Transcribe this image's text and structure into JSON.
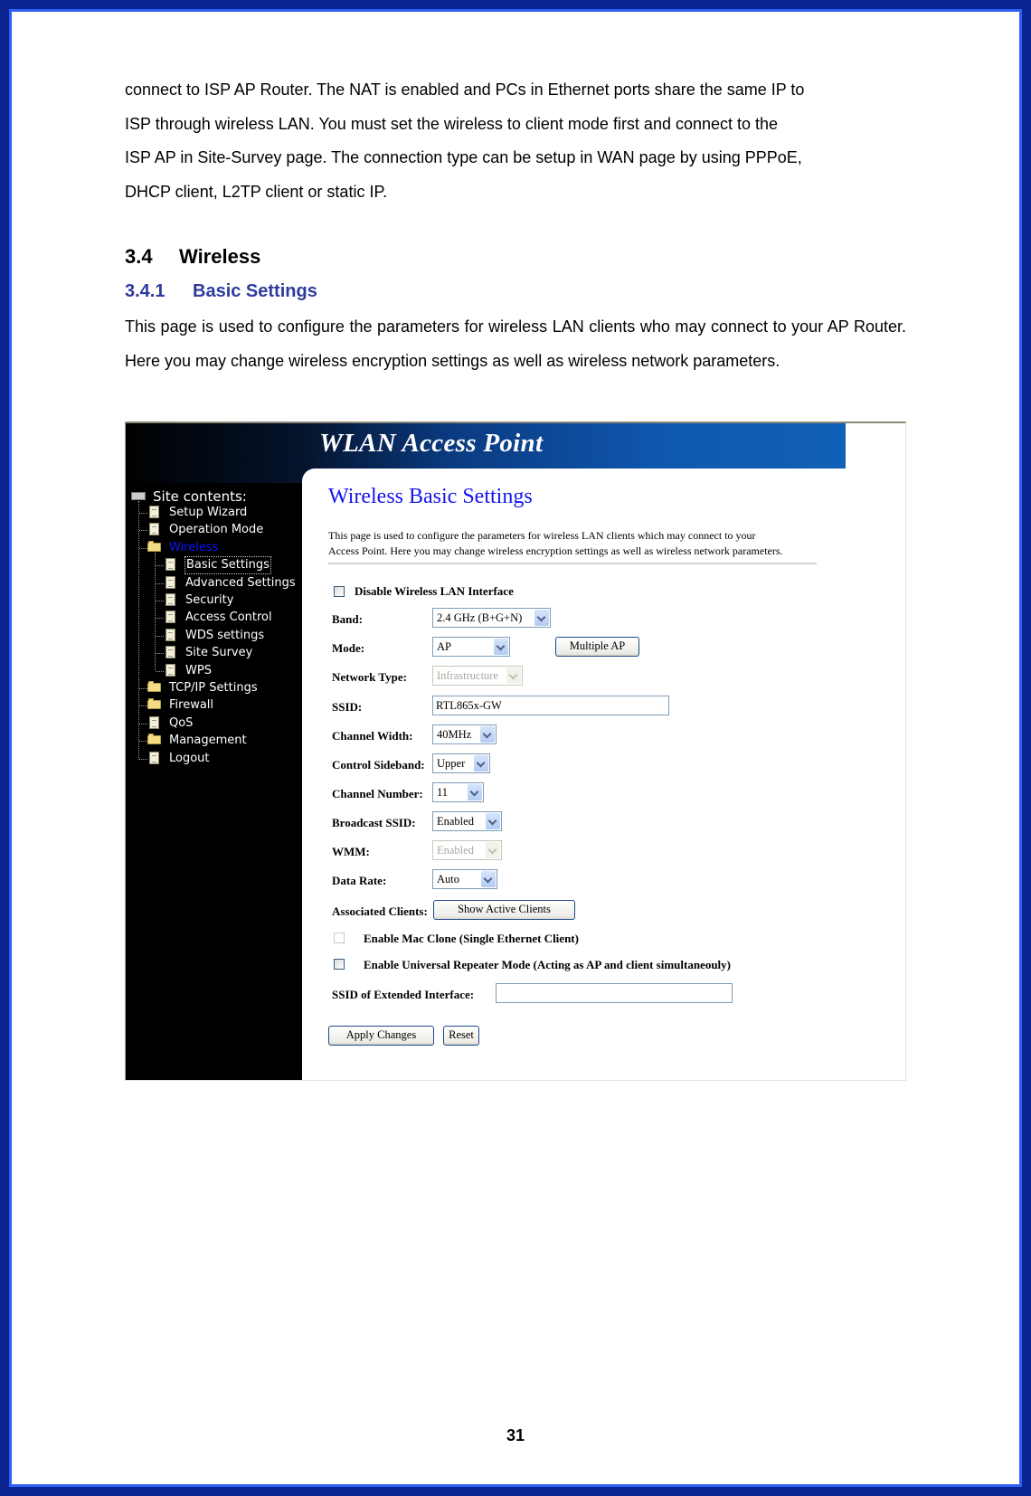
{
  "document": {
    "intro_paragraph": "connect to ISP AP Router. The NAT is enabled and PCs in Ethernet ports share the same IP to ISP through wireless LAN. You must set the wireless to client mode first and connect to the ISP AP in Site-Survey page. The connection type can be setup in WAN page by using PPPoE, DHCP client, L2TP client or static IP.",
    "intro_lines": [
      "connect to ISP AP Router. The NAT is enabled and PCs in Ethernet ports share the same IP to",
      "ISP through wireless LAN. You must set the wireless to client mode first and connect to the",
      "ISP AP in Site-Survey page. The connection type can be setup in WAN page by using PPPoE,",
      "DHCP client, L2TP client or static IP."
    ],
    "section": {
      "number": "3.4",
      "title": "Wireless"
    },
    "subsection": {
      "number": "3.4.1",
      "title": "Basic Settings"
    },
    "description": "This page is used to configure the parameters for wireless LAN clients who may connect to your AP Router. Here you may change wireless encryption settings as well as wireless network parameters.",
    "page_number": "31",
    "colors": {
      "frame_outer": "#0a2590",
      "frame_inner": "#2f5ff2",
      "subsection_heading": "#2e3b9c"
    }
  },
  "screenshot": {
    "header_title": "WLAN Access Point",
    "sidebar": {
      "root_label": "Site contents:",
      "items": [
        {
          "label": "Setup Wizard",
          "icon": "document-icon",
          "level": 0
        },
        {
          "label": "Operation Mode",
          "icon": "document-icon",
          "level": 0
        },
        {
          "label": "Wireless",
          "icon": "folder-open-icon",
          "level": 0,
          "active": true
        },
        {
          "label": "Basic Settings",
          "icon": "document-icon",
          "level": 1,
          "selected": true
        },
        {
          "label": "Advanced Settings",
          "icon": "document-icon",
          "level": 1
        },
        {
          "label": "Security",
          "icon": "document-icon",
          "level": 1
        },
        {
          "label": "Access Control",
          "icon": "document-icon",
          "level": 1
        },
        {
          "label": "WDS settings",
          "icon": "document-icon",
          "level": 1
        },
        {
          "label": "Site Survey",
          "icon": "document-icon",
          "level": 1
        },
        {
          "label": "WPS",
          "icon": "document-icon",
          "level": 1
        },
        {
          "label": "TCP/IP Settings",
          "icon": "folder-icon",
          "level": 0
        },
        {
          "label": "Firewall",
          "icon": "folder-icon",
          "level": 0
        },
        {
          "label": "QoS",
          "icon": "document-icon",
          "level": 0
        },
        {
          "label": "Management",
          "icon": "folder-icon",
          "level": 0
        },
        {
          "label": "Logout",
          "icon": "document-icon",
          "level": 0
        }
      ]
    },
    "form": {
      "title": "Wireless Basic Settings",
      "description_line1": "This page is used to configure the parameters for wireless LAN clients which may connect to your",
      "description_line2": "Access Point. Here you may change wireless encryption settings as well as wireless network parameters.",
      "disable_wlan": {
        "label": "Disable Wireless LAN Interface",
        "checked": false
      },
      "band": {
        "label": "Band:",
        "value": "2.4 GHz (B+G+N)"
      },
      "mode": {
        "label": "Mode:",
        "value": "AP",
        "multiple_ap_button": "Multiple AP"
      },
      "network_type": {
        "label": "Network Type:",
        "value": "Infrastructure",
        "disabled": true
      },
      "ssid": {
        "label": "SSID:",
        "value": "RTL865x-GW"
      },
      "channel_width": {
        "label": "Channel Width:",
        "value": "40MHz"
      },
      "control_sideband": {
        "label": "Control Sideband:",
        "value": "Upper"
      },
      "channel_number": {
        "label": "Channel Number:",
        "value": "11"
      },
      "broadcast_ssid": {
        "label": "Broadcast SSID:",
        "value": "Enabled"
      },
      "wmm": {
        "label": "WMM:",
        "value": "Enabled",
        "disabled": true
      },
      "data_rate": {
        "label": "Data Rate:",
        "value": "Auto"
      },
      "associated_clients": {
        "label": "Associated Clients:",
        "button": "Show Active Clients"
      },
      "mac_clone": {
        "label": "Enable Mac Clone (Single Ethernet Client)",
        "checked": false
      },
      "universal_repeater": {
        "label": "Enable Universal Repeater Mode (Acting as AP and client simultaneouly)",
        "checked": false
      },
      "extended_ssid": {
        "label": "SSID of Extended Interface:",
        "value": ""
      },
      "apply_button": "Apply Changes",
      "reset_button": "Reset"
    }
  }
}
